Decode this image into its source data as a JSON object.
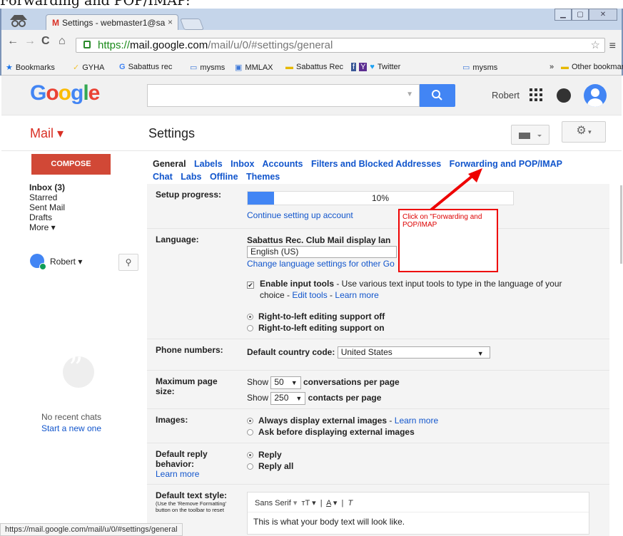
{
  "caption": "Forwarding and POP/IMAP:",
  "browser": {
    "tab_title": "Settings - webmaster1@sa",
    "tab_close": "×",
    "url_https": "https://",
    "url_host": "mail.google.com",
    "url_path": "/mail/u/0/#settings/general",
    "bookmarks": [
      "Bookmarks",
      "GYHA",
      "Sabattus rec",
      "mysms",
      "MMLAX",
      "Sabattus Rec",
      "Twitter",
      "mysms"
    ],
    "bookmarks_overflow": "»",
    "other_bookmarks": "Other bookmarks"
  },
  "google_header": {
    "logo": "Google",
    "user_name": "Robert"
  },
  "subheader": {
    "mail_label": "Mail ▾",
    "settings_title": "Settings"
  },
  "sidebar": {
    "compose": "COMPOSE",
    "folders": [
      {
        "label": "Inbox (3)",
        "bold": true
      },
      {
        "label": "Starred",
        "bold": false
      },
      {
        "label": "Sent Mail",
        "bold": false
      },
      {
        "label": "Drafts",
        "bold": false
      },
      {
        "label": "More ▾",
        "bold": false
      }
    ],
    "chat_user": "Robert ▾",
    "no_recent": "No recent chats",
    "start_new": "Start a new one"
  },
  "settings_tabs": {
    "row1": [
      "General",
      "Labels",
      "Inbox",
      "Accounts",
      "Filters and Blocked Addresses",
      "Forwarding and POP/IMAP"
    ],
    "row2": [
      "Chat",
      "Labs",
      "Offline",
      "Themes"
    ]
  },
  "setup": {
    "label": "Setup progress:",
    "percent_text": "10%",
    "progress": 0.1,
    "continue_link": "Continue setting up account"
  },
  "language": {
    "label": "Language:",
    "title": "Sabattus Rec. Club Mail display lan",
    "selected": "English (US)",
    "change_link": "Change language settings for other Go",
    "input_tools_bold": "Enable input tools",
    "input_tools_text": " - Use various text input tools to type in the language of your",
    "input_tools_text2": "choice - ",
    "edit_tools": "Edit tools",
    "dash": " - ",
    "learn_more": "Learn more",
    "rtl_off": "Right-to-left editing support off",
    "rtl_on": "Right-to-left editing support on"
  },
  "phone": {
    "label": "Phone numbers:",
    "country_label": "Default country code:",
    "country_value": "United States"
  },
  "page_size": {
    "label": "Maximum page size:",
    "show": "Show",
    "conv_value": "50",
    "conv_text": "conversations per page",
    "contacts_value": "250",
    "contacts_text": "contacts per page"
  },
  "images": {
    "label": "Images:",
    "always": "Always display external images",
    "learn_more": "Learn more",
    "ask": "Ask before displaying external images"
  },
  "reply": {
    "label": "Default reply behavior:",
    "learn_more": "Learn more",
    "reply": "Reply",
    "reply_all": "Reply all"
  },
  "text_style": {
    "label": "Default text style:",
    "note": "(Use the 'Remove Formatting' button on the toolbar to reset",
    "font": "Sans Serif",
    "sample": "This is what your body text will look like."
  },
  "annotation": {
    "text": "Click on \"Forwarding and POP/IMAP"
  },
  "status_url": "https://mail.google.com/mail/u/0/#settings/general"
}
